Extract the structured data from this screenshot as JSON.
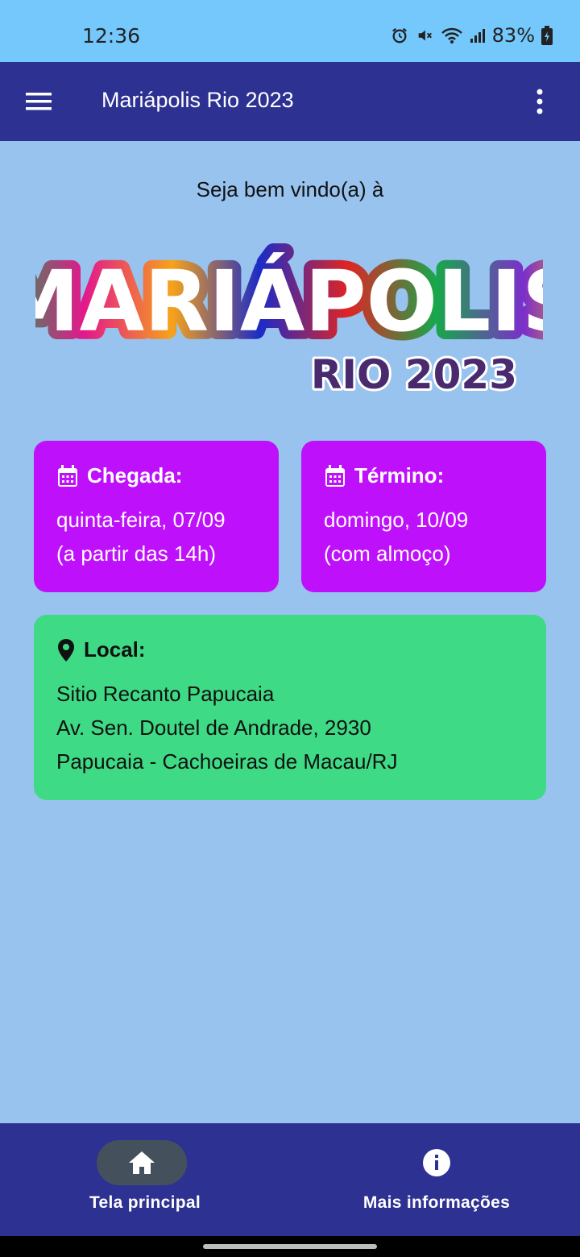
{
  "status_bar": {
    "time": "12:36",
    "battery": "83%"
  },
  "app_bar": {
    "title": "Mariápolis Rio 2023"
  },
  "welcome": "Seja bem vindo(a) à",
  "logo": {
    "main": "MARIÁPOLIS",
    "sub": "RIO 2023"
  },
  "arrival": {
    "title": "Chegada:",
    "line1": "quinta-feira, 07/09",
    "line2": "(a partir das 14h)",
    "color": "#bf10fb"
  },
  "departure": {
    "title": "Término:",
    "line1": "domingo, 10/09",
    "line2": "(com almoço)",
    "color": "#bf10fb"
  },
  "location": {
    "title": "Local:",
    "line1": "Sitio Recanto Papucaia",
    "line2": "Av. Sen. Doutel de Andrade, 2930",
    "line3": "Papucaia - Cachoeiras de Macau/RJ",
    "color": "#3fda85"
  },
  "bottom_nav": {
    "home": "Tela principal",
    "info": "Mais informações"
  },
  "colors": {
    "app_bar": "#2d3192",
    "background": "#98c3ee",
    "status_bar": "#75c8fb"
  }
}
